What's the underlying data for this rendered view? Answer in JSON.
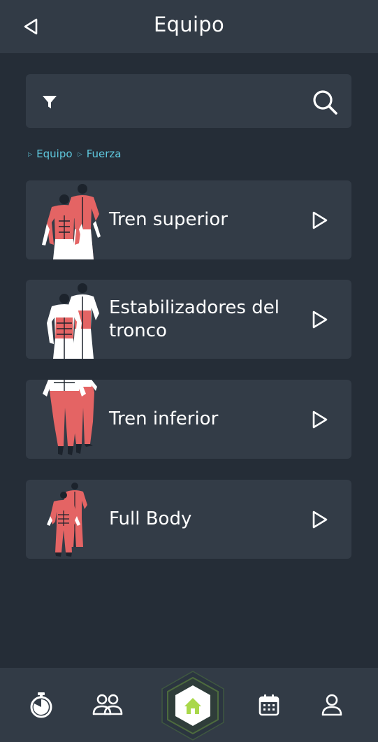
{
  "header": {
    "title": "Equipo",
    "back_icon": "back-triangle-icon"
  },
  "search": {
    "filter_icon": "filter-icon",
    "search_icon": "search-icon"
  },
  "breadcrumb": {
    "items": [
      "Equipo",
      "Fuerza"
    ]
  },
  "categories": [
    {
      "label": "Tren superior",
      "icon": "upper-body-muscles-icon"
    },
    {
      "label": "Estabilizadores del tronco",
      "icon": "core-muscles-icon"
    },
    {
      "label": "Tren inferior",
      "icon": "lower-body-muscles-icon"
    },
    {
      "label": "Full Body",
      "icon": "full-body-muscles-icon"
    }
  ],
  "bottom_nav": {
    "items": [
      "stopwatch-icon",
      "users-icon",
      "home-icon",
      "calendar-icon",
      "profile-icon"
    ],
    "active": "home-icon"
  },
  "colors": {
    "background": "#252d37",
    "surface": "#333c47",
    "accent": "#5fc8de",
    "muscle_highlight": "#e46464",
    "home_active": "#a9d84a"
  }
}
